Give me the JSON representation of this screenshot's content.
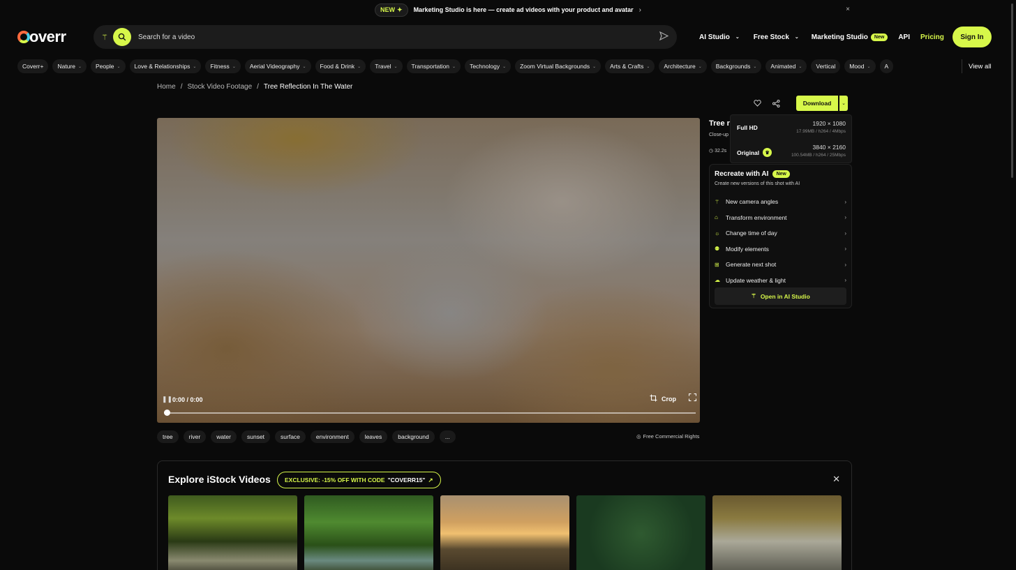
{
  "announcement": {
    "badge": "NEW",
    "text": "Marketing Studio is here — create ad videos with your product and avatar",
    "close": "×"
  },
  "logo": {
    "text": "overr"
  },
  "search": {
    "placeholder": "Search for a video"
  },
  "nav": {
    "ai_studio": "AI Studio",
    "free_stock": "Free Stock",
    "marketing_studio": "Marketing Studio",
    "new_badge": "New",
    "api": "API",
    "pricing": "Pricing",
    "sign_in": "Sign In"
  },
  "categories": [
    "Coverr+",
    "Nature",
    "People",
    "Love & Relationships",
    "Fitness",
    "Aerial Videography",
    "Food & Drink",
    "Travel",
    "Transportation",
    "Technology",
    "Zoom Virtual Backgrounds",
    "Arts & Crafts",
    "Architecture",
    "Backgrounds",
    "Animated",
    "Vertical",
    "Mood",
    "A"
  ],
  "view_all": "View all",
  "breadcrumb": {
    "home": "Home",
    "section": "Stock Video Footage",
    "current": "Tree Reflection In The Water"
  },
  "actions": {
    "download": "Download"
  },
  "video": {
    "time": "0:00 / 0:00",
    "crop": "Crop",
    "progress": 0
  },
  "details": {
    "title": "Tree r",
    "subtitle": "Close-up",
    "duration": "32.2s"
  },
  "download_options": [
    {
      "name": "Full HD",
      "resolution": "1920 × 1080",
      "meta": "17.99MB / h264 / 4Mbps"
    },
    {
      "name": "Original",
      "resolution": "3840 × 2160",
      "meta": "100.54MB / h264 / 25Mbps"
    }
  ],
  "recreate": {
    "title": "Recreate with AI",
    "badge": "New",
    "subtitle": "Create new versions of this shot with AI",
    "items": [
      "New camera angles",
      "Transform environment",
      "Change time of day",
      "Modify elements",
      "Generate next shot",
      "Update weather & light"
    ],
    "open": "Open in AI Studio"
  },
  "tags": [
    "tree",
    "river",
    "water",
    "sunset",
    "surface",
    "environment",
    "leaves",
    "background",
    "..."
  ],
  "rights": "Free Commercial Rights",
  "istock": {
    "title": "Explore iStock Videos",
    "code_label": "EXCLUSIVE: -15% OFF WITH CODE",
    "code": "\"COVERR15\""
  },
  "colors": {
    "accent": "#d7f74a",
    "background": "#0a0a0a"
  }
}
